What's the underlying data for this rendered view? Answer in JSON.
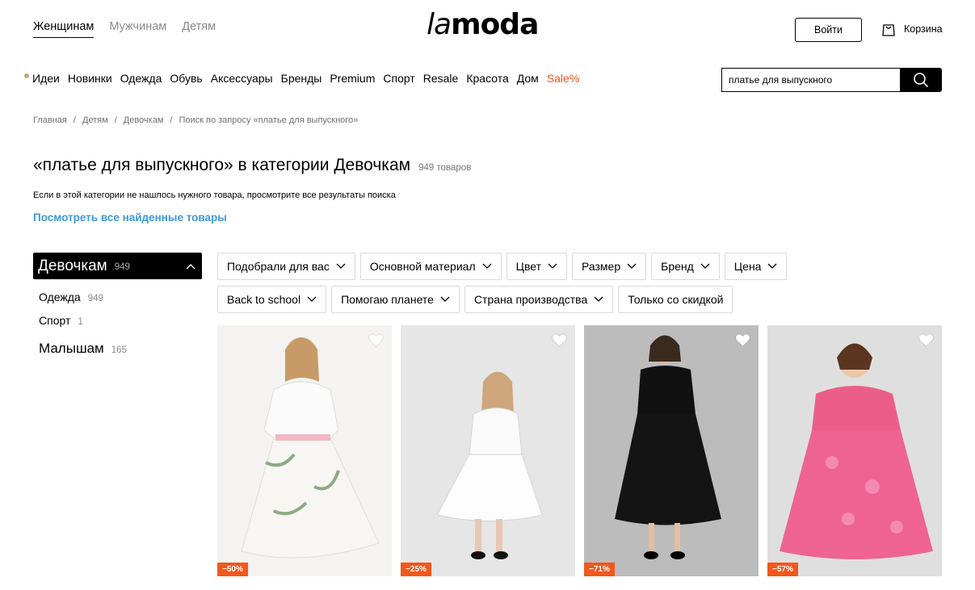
{
  "header": {
    "nav": [
      "Женщинам",
      "Мужчинам",
      "Детям"
    ],
    "logo": "lamoda",
    "login_label": "Войти",
    "cart_label": "Корзина"
  },
  "categories": [
    "Идеи",
    "Новинки",
    "Одежда",
    "Обувь",
    "Аксессуары",
    "Бренды",
    "Premium",
    "Спорт",
    "Resale",
    "Красота",
    "Дом",
    "Sale%"
  ],
  "search": {
    "value": "платье для выпускного"
  },
  "breadcrumb": [
    "Главная",
    "Детям",
    "Девочкам",
    "Поиск по запросу «платье для выпускного»"
  ],
  "title": "«платье для выпускного» в категории Девочкам",
  "count": "949 товаров",
  "hint": "Если в этой категории не нашлось нужного товара, просмотрите все результаты поиска",
  "see_all": "Посмотреть все найденные товары",
  "sidebar": {
    "active": {
      "label": "Девочкам",
      "count": "949"
    },
    "items": [
      {
        "label": "Одежда",
        "count": "949"
      },
      {
        "label": "Спорт",
        "count": "1"
      },
      {
        "label": "Малышам",
        "count": "165"
      }
    ]
  },
  "filters": {
    "row1": [
      "Подобрали для вас",
      "Основной материал",
      "Цвет",
      "Размер",
      "Бренд",
      "Цена"
    ],
    "row2": [
      "Back to school",
      "Помогаю планете",
      "Страна производства",
      "Только со скидкой"
    ]
  },
  "products": [
    {
      "discount": "−50%"
    },
    {
      "discount": "−25%"
    },
    {
      "discount": "−71%"
    },
    {
      "discount": "−57%"
    }
  ],
  "colors": {
    "sale": "#f2571c",
    "link": "#3d99d8",
    "accent_dot": "#c7a77d"
  }
}
